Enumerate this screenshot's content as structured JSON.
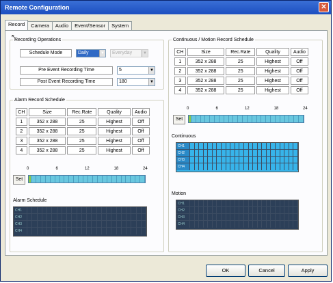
{
  "window": {
    "title": "Remote Configuration",
    "close_icon": "close-icon"
  },
  "tabs": [
    {
      "label": "Record"
    },
    {
      "label": "Camera"
    },
    {
      "label": "Audio"
    },
    {
      "label": "Event/Sensor"
    },
    {
      "label": "System"
    }
  ],
  "recording_ops": {
    "legend": "Recording Operations",
    "schedule_mode_label": "Schedule Mode",
    "schedule_mode_value": "Daily",
    "schedule_mode_sub": "Everyday",
    "pre_label": "Pre Event Recording Time",
    "pre_value": "5",
    "post_label": "Post Event Recording Time",
    "post_value": "180"
  },
  "alarm": {
    "legend": "Alarm Record Schedule",
    "headers": [
      "CH",
      "Size",
      "Rec.Rate",
      "Quality",
      "Audio"
    ],
    "rows": [
      [
        "1",
        "352 x 288",
        "25",
        "Highest",
        "Off"
      ],
      [
        "2",
        "352 x 288",
        "25",
        "Highest",
        "Off"
      ],
      [
        "3",
        "352 x 288",
        "25",
        "Highest",
        "Off"
      ],
      [
        "4",
        "352 x 288",
        "25",
        "Highest",
        "Off"
      ]
    ],
    "set_label": "Set",
    "scale": [
      "0",
      "6",
      "12",
      "18",
      "24"
    ],
    "schedule_label": "Alarm Schedule",
    "channels": [
      "CH1",
      "CH2",
      "CH3",
      "CH4"
    ]
  },
  "continuous": {
    "legend": "Continuous / Motion Record Schedule",
    "headers": [
      "CH",
      "Size",
      "Rec.Rate",
      "Quality",
      "Audio"
    ],
    "rows": [
      [
        "1",
        "352 x 288",
        "25",
        "Highest",
        "Off"
      ],
      [
        "2",
        "352 x 288",
        "25",
        "Highest",
        "Off"
      ],
      [
        "3",
        "352 x 288",
        "25",
        "Highest",
        "Off"
      ],
      [
        "4",
        "352 x 288",
        "25",
        "Highest",
        "Off"
      ]
    ],
    "set_label": "Set",
    "scale": [
      "0",
      "6",
      "12",
      "18",
      "24"
    ],
    "continuous_label": "Continuous",
    "motion_label": "Motion",
    "channels": [
      "CH1",
      "CH2",
      "CH3",
      "CH4"
    ]
  },
  "buttons": {
    "ok": "OK",
    "cancel": "Cancel",
    "apply": "Apply"
  },
  "colors": {
    "title_bar": "#1c4fc0",
    "schedule_on": "#37b4ea",
    "schedule_off": "#2c3f58",
    "bar_fill": "#69c7df"
  }
}
